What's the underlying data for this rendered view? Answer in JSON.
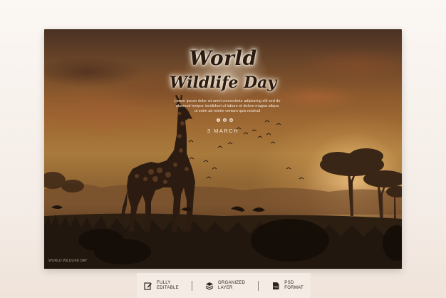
{
  "banner": {
    "title_line1": "World",
    "title_line2": "Wildlife Day",
    "description": "Lorem ipsum dolor sit amet consectetur adipiscing elit sed do eiusmod tempor incididunt ut labore et dolore magna aliqua ut enim ad minim veniam quis nostrud",
    "social_icons": [
      "facebook-icon",
      "instagram-icon",
      "globe-icon"
    ],
    "date": "3 MARCH",
    "watermark": "WORLD WILDLIFE DAY"
  },
  "features": [
    {
      "icon": "edit-icon",
      "line1": "FULLY",
      "line2": "EDITABLE"
    },
    {
      "icon": "layers-icon",
      "line1": "ORGANIZED",
      "line2": "LAYER"
    },
    {
      "icon": "psd-file-icon",
      "line1": "PSD",
      "line2": "FORMAT"
    }
  ],
  "colors": {
    "sky_dark": "#4a3123",
    "sky_orange": "#9f6a33",
    "ground_dark": "#261a10",
    "silhouette": "#1c130c",
    "title_text": "#2a1a10",
    "page_bg": "#f4ece6"
  }
}
